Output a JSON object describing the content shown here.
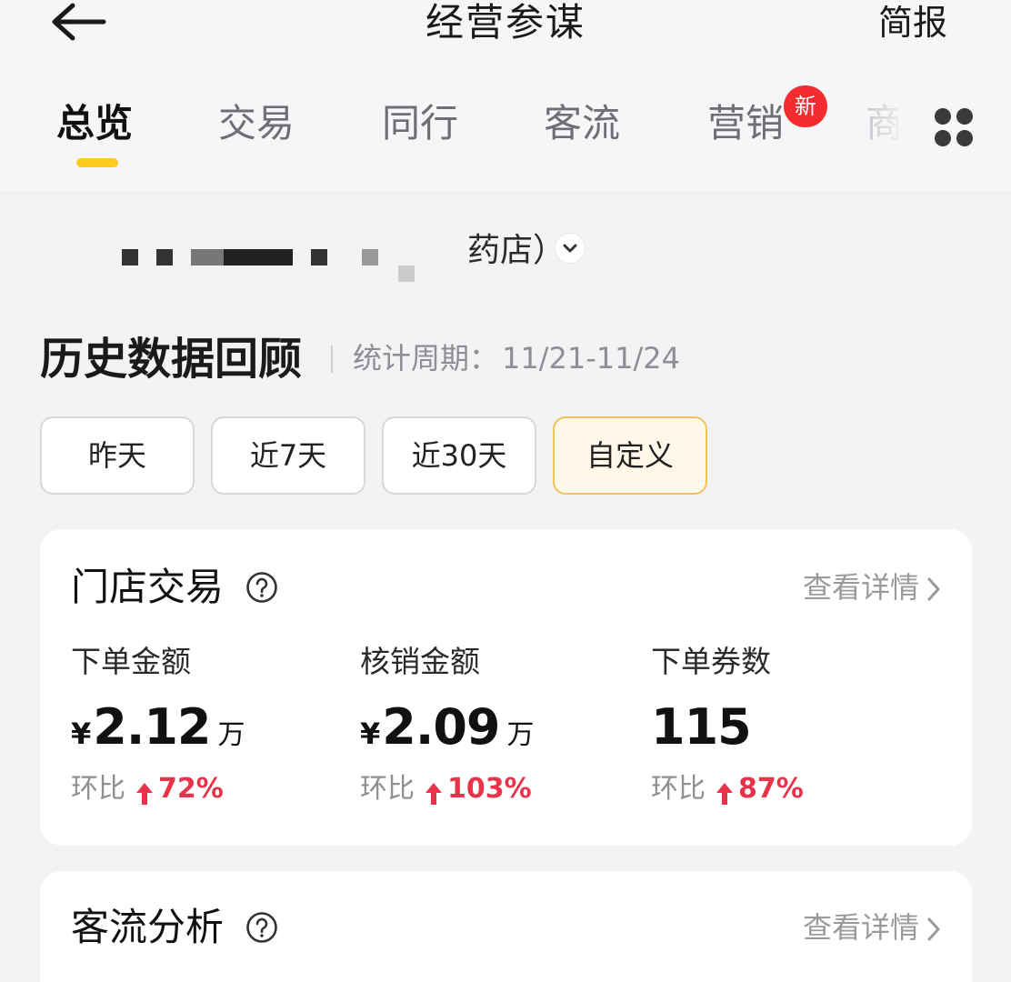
{
  "header": {
    "title": "经营参谋",
    "report_label": "简报"
  },
  "tabs": [
    {
      "label": "总览",
      "active": true
    },
    {
      "label": "交易",
      "active": false
    },
    {
      "label": "同行",
      "active": false
    },
    {
      "label": "客流",
      "active": false
    },
    {
      "label": "营销",
      "active": false,
      "badge": "新"
    },
    {
      "label": "商",
      "active": false
    }
  ],
  "store": {
    "name_suffix": "药店）"
  },
  "history": {
    "title": "历史数据回顾",
    "period_label": "统计周期：",
    "period_value": "11/21-11/24",
    "filters": [
      {
        "label": "昨天",
        "selected": false
      },
      {
        "label": "近7天",
        "selected": false
      },
      {
        "label": "近30天",
        "selected": false
      },
      {
        "label": "自定义",
        "selected": true
      }
    ]
  },
  "store_transactions": {
    "title": "门店交易",
    "detail_label": "查看详情",
    "metrics": [
      {
        "label": "下单金额",
        "currency": "¥",
        "value": "2.12",
        "unit": "万",
        "change_label": "环比",
        "change": "72%"
      },
      {
        "label": "核销金额",
        "currency": "¥",
        "value": "2.09",
        "unit": "万",
        "change_label": "环比",
        "change": "103%"
      },
      {
        "label": "下单券数",
        "currency": "",
        "value": "115",
        "unit": "",
        "change_label": "环比",
        "change": "87%"
      }
    ]
  },
  "traffic_analysis": {
    "title": "客流分析",
    "detail_label": "查看详情"
  },
  "colors": {
    "accent_yellow": "#ffcb1f",
    "badge_red": "#f32c32",
    "up_red": "#e8334a",
    "chip_selected_bg": "#fff8e9",
    "chip_selected_border": "#f1c45a"
  },
  "icons": {
    "back": "arrow-left-icon",
    "more": "grid-dots-icon",
    "help": "question-circle-icon",
    "detail": "chevron-right-icon",
    "store_toggle": "chevron-down-icon",
    "change_up": "arrow-up-icon"
  }
}
